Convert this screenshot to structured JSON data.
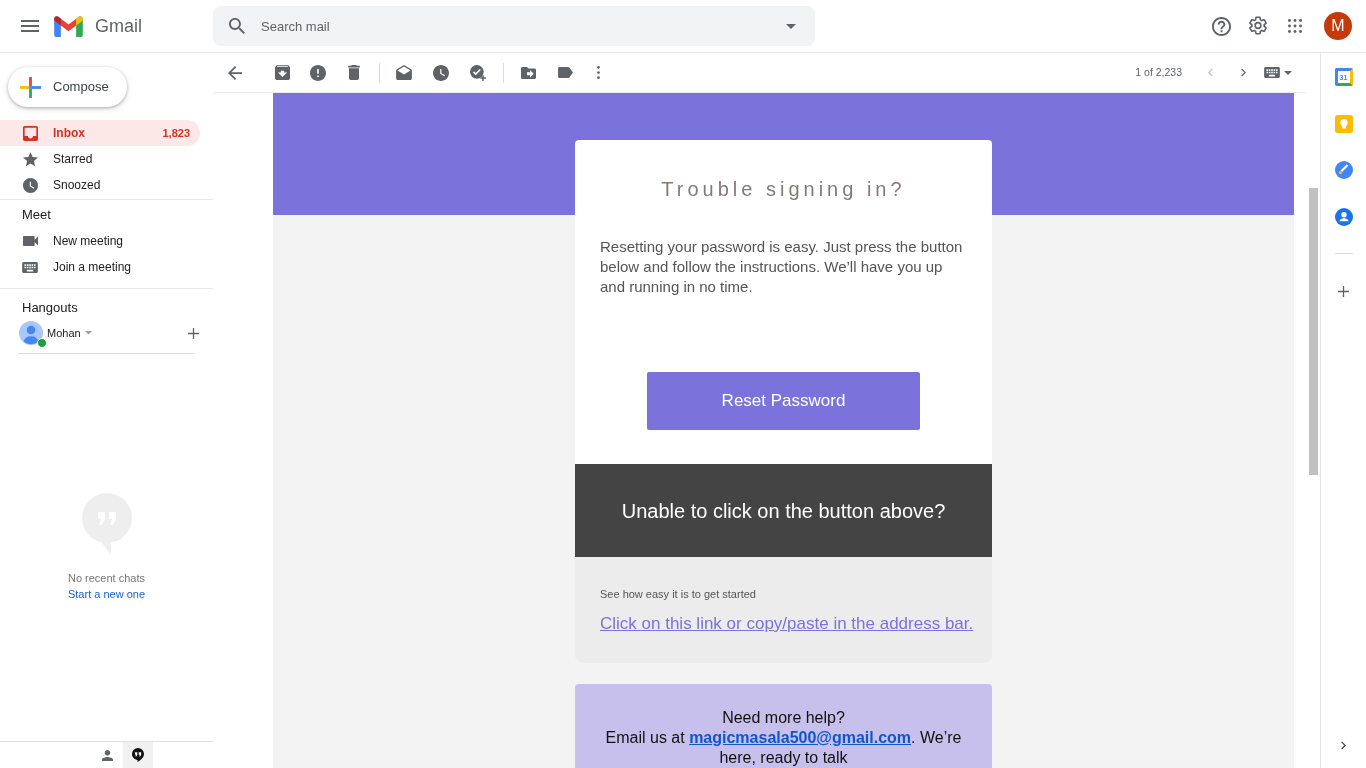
{
  "header": {
    "app_name": "Gmail",
    "search_placeholder": "Search mail",
    "account_initial": "M"
  },
  "sidebar": {
    "compose": "Compose",
    "folders": [
      {
        "kind": "inbox",
        "label": "Inbox",
        "count": "1,823",
        "selected": true
      },
      {
        "kind": "starred",
        "label": "Starred",
        "selected": false
      },
      {
        "kind": "snoozed",
        "label": "Snoozed",
        "selected": false
      }
    ],
    "meet": {
      "title": "Meet",
      "items": [
        {
          "kind": "video",
          "label": "New meeting"
        },
        {
          "kind": "keyboard",
          "label": "Join a meeting"
        }
      ]
    },
    "hangouts": {
      "title": "Hangouts",
      "user": {
        "name": "Mohan",
        "online": true
      },
      "empty_text": "No recent chats",
      "start_link": "Start a new one",
      "tabs": [
        {
          "kind": "contacts",
          "selected": false
        },
        {
          "kind": "chats",
          "selected": true
        }
      ]
    }
  },
  "toolbar": {
    "position": "1 of 2,233",
    "newer_disabled": true
  },
  "email": {
    "heading": "Trouble signing in?",
    "intro": "Resetting your password is easy. Just press the button below and follow the instructions. We’ll have you up and running in no time.",
    "button": "Reset Password",
    "fallback_heading": "Unable to click on the button above?",
    "fallback_hint": "See how easy it is to get started",
    "fallback_link": "Click on this link or copy/paste in the address bar.",
    "help_title": "Need more help?",
    "help_text_before": "Email us at ",
    "help_email": "magicmasala500@gmail.com",
    "help_text_after": ". We’re here, ready to talk"
  },
  "side_panel": {
    "apps": [
      {
        "kind": "calendar",
        "day": "31"
      },
      {
        "kind": "keep"
      },
      {
        "kind": "tasks"
      },
      {
        "kind": "contacts"
      }
    ]
  }
}
